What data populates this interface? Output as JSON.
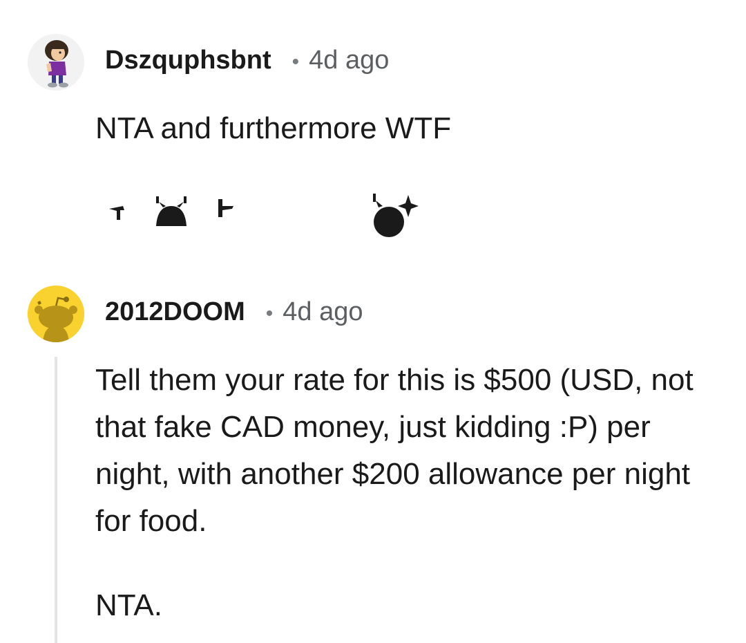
{
  "comments": [
    {
      "username": "Dszquphsbnt",
      "separator": "•",
      "time": "4d ago",
      "body": "NTA and furthermore WTF",
      "avatar_icon": "character-avatar-icon",
      "emotes": [
        "pointing-face-emote-icon",
        "sparkle-face-emote-icon"
      ]
    },
    {
      "username": "2012DOOM",
      "separator": "•",
      "time": "4d ago",
      "paragraphs": [
        "Tell them your rate for this is $500 (USD, not that fake CAD money, just kidding :P) per night, with another $200 allowance per night for food.",
        "NTA."
      ],
      "avatar_icon": "snoo-avatar-icon",
      "avatar_color": "#f9d230"
    }
  ]
}
